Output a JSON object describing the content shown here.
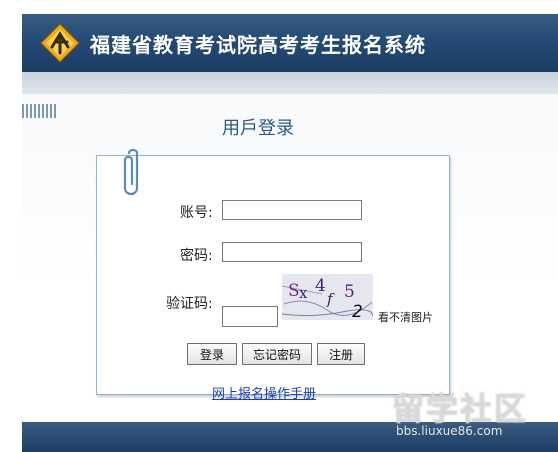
{
  "header": {
    "title": "福建省教育考试院高考考生报名系统"
  },
  "login": {
    "title": "用戶登录",
    "account_label": "账号:",
    "account_value": "",
    "password_label": "密码:",
    "password_value": "",
    "captcha_label": "验证码:",
    "captcha_value": "",
    "captcha_text": "Sx4f52",
    "cant_see_label": "看不清图片",
    "login_button": "登录",
    "forgot_button": "忘记密码",
    "register_button": "注册",
    "manual_link": "网上报名操作手册"
  },
  "watermark": {
    "text": "留学社区",
    "url": "bbs.liuxue86.com"
  },
  "colors": {
    "header": "#244a75",
    "title": "#2b5a8a",
    "link": "#1a3fbf",
    "panel_border": "#8fb4d2"
  }
}
